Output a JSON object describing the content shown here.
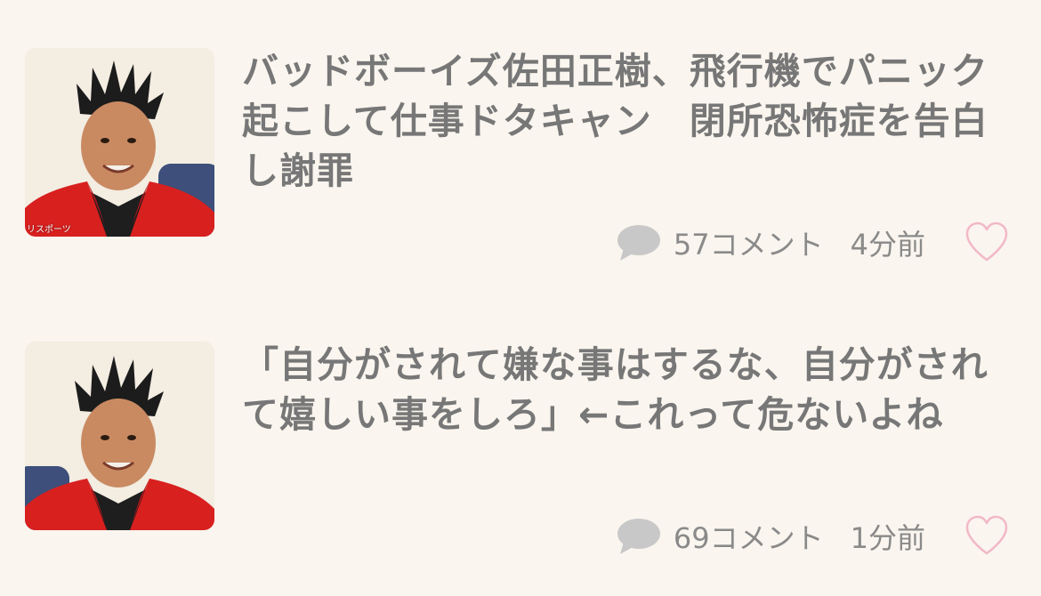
{
  "articles": [
    {
      "title": "バッドボーイズ佐田正樹、飛行機でパニック起こして仕事ドタキャン　閉所恐怖症を告白し謝罪",
      "comments": "57コメント",
      "time": "4分前",
      "image_credit": "リスポーツ"
    },
    {
      "title": "「自分がされて嫌な事はするな、自分がされて嬉しい事をしろ」←これって危ないよね",
      "comments": "69コメント",
      "time": "1分前"
    }
  ],
  "colors": {
    "background": "#faf5ee",
    "title_text": "#777777",
    "meta_text": "#8a8a8a",
    "comment_icon": "#c8c8c8",
    "heart_outline": "#f2b8c6",
    "jacket": "#d8201f"
  },
  "icons": [
    "comment-bubble-icon",
    "heart-outline-icon"
  ]
}
